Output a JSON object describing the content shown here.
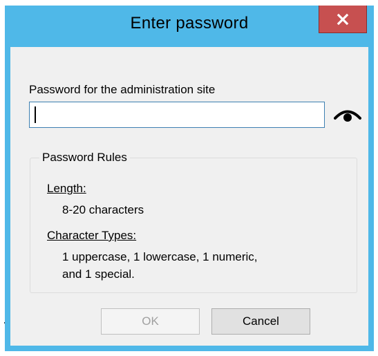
{
  "dialog": {
    "title": "Enter password",
    "close_symbol": "x"
  },
  "password_field": {
    "label": "Password for the administration site",
    "value": "",
    "reveal_icon": "eye-icon"
  },
  "rules": {
    "group_title": "Password Rules",
    "length_heading": "Length:",
    "length_text": "8-20 characters",
    "types_heading": "Character Types:",
    "types_text_line1": "1 uppercase, 1 lowercase, 1 numeric,",
    "types_text_line2": "and 1 special."
  },
  "buttons": {
    "ok_label": "OK",
    "ok_enabled": false,
    "cancel_label": "Cancel"
  },
  "colors": {
    "titlebar": "#4fb8e8",
    "close_button": "#c75050",
    "client_bg": "#f0f0f0",
    "input_border": "#3c7fb1"
  }
}
